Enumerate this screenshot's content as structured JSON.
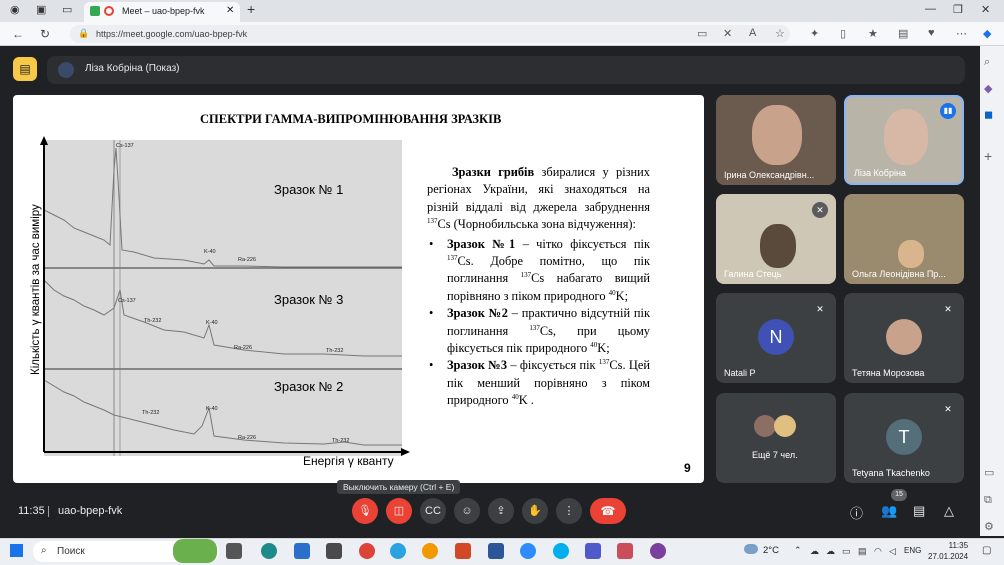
{
  "browser": {
    "tab_title": "Meet – uao-bpep-fvk",
    "url": "https://meet.google.com/uao-bpep-fvk"
  },
  "meet": {
    "presenter_label": "Ліза Кобріна (Показ)",
    "time": "11:35",
    "meeting_code": "uao-bpep-fvk",
    "tooltip": "Выключить камеру (Ctrl + E)",
    "people_count": "15"
  },
  "slide": {
    "title": "СПЕКТРИ ГАММА-ВИПРОМІНЮВАННЯ ЗРАЗКІВ",
    "y_axis_label": "Кількість γ квантів за час виміру",
    "x_axis_label": "Енергія γ кванту",
    "samples": [
      "Зразок № 1",
      "Зразок № 3",
      "Зразок № 2"
    ],
    "peaks": {
      "p1": [
        "Cs-137",
        "K-40",
        "Ra-226"
      ],
      "p3": [
        "Cs-137",
        "Th-232",
        "K-40",
        "Ra-226",
        "Th-232"
      ],
      "p2": [
        "Th-232",
        "K-40",
        "Ra-226",
        "Th-232"
      ]
    },
    "page_number": "9",
    "intro_bold": "Зразки грибів",
    "intro_rest": "збиралися у різних регіонах України, які знаходяться на різній віддалі від джерела забруднення",
    "intro_tail": "Cs (Чорнобильська зона відчуження):",
    "sup_137": "137",
    "sup_40": "40",
    "b1_bold": "Зразок №1",
    "b1_text_a": "– чітко фіксується пік",
    "b1_text_b": "Cs. Добре помітно, що пік поглинання",
    "b1_text_c": "Cs набагато вищий порівняно з піком природного",
    "b1_text_d": "K;",
    "b2_bold": "Зразок №2",
    "b2_text_a": "– практично відсутній пік поглинання",
    "b2_text_b": "Cs, при цьому фіксується пік природного",
    "b2_text_c": "K;",
    "b3_bold": "Зразок №3",
    "b3_text_a": "– фіксується пік",
    "b3_text_b": "Cs. Цей пік менший порівняно з піком природного",
    "b3_text_c": "K ."
  },
  "participants": [
    {
      "name": "Ірина Олександрівн...",
      "muted": false
    },
    {
      "name": "Ліза Кобріна",
      "muted": false,
      "speaking": true
    },
    {
      "name": "Галина Стець",
      "muted": true
    },
    {
      "name": "Ольга Леонідівна Пр...",
      "muted": false
    },
    {
      "name": "Natali P",
      "muted": true,
      "initial": "N",
      "color": "#3f51b5"
    },
    {
      "name": "Тетяна Морозова",
      "muted": true
    },
    {
      "name": "Ещё 7 чел.",
      "muted": false
    },
    {
      "name": "Tetyana Tkachenko",
      "muted": true,
      "initial": "T",
      "color": "#546e7a"
    }
  ],
  "taskbar": {
    "search_label": "Поиск",
    "weather": "2°C",
    "lang": "ENG",
    "time": "11:35",
    "date": "27.01.2024"
  }
}
